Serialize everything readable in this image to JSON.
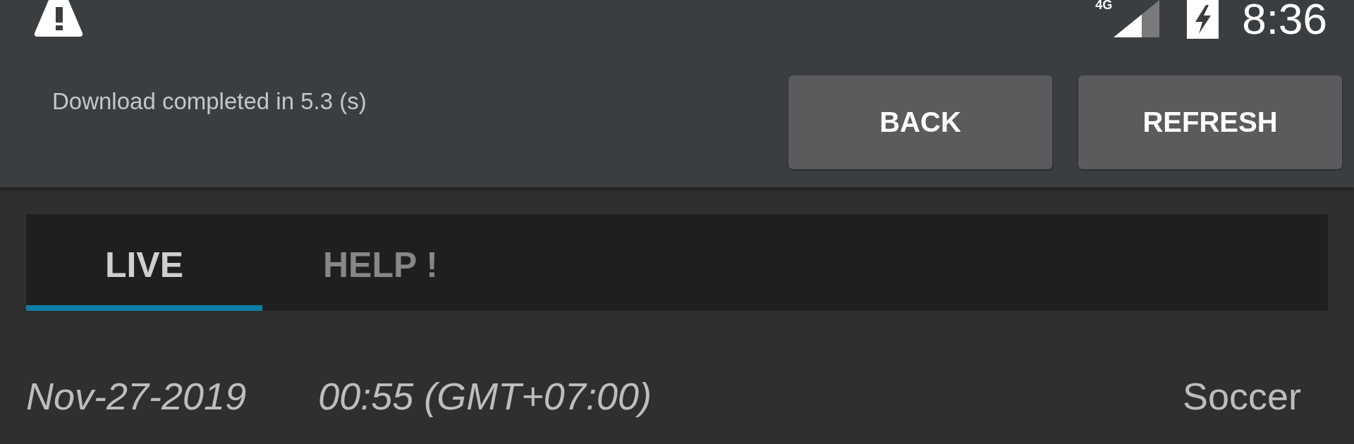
{
  "status_bar": {
    "network": "4G",
    "time": "8:36"
  },
  "notice": {
    "text": "Download completed in 5.3 (s)"
  },
  "buttons": [
    {
      "label": "BACK"
    },
    {
      "label": "REFRESH"
    }
  ],
  "tabs": [
    {
      "label": "LIVE",
      "selected": true
    },
    {
      "label": "HELP !",
      "selected": false
    }
  ],
  "events": [
    {
      "date": "Nov-27-2019",
      "time": "00:55 (GMT+07:00)",
      "sport": "Soccer"
    }
  ]
}
